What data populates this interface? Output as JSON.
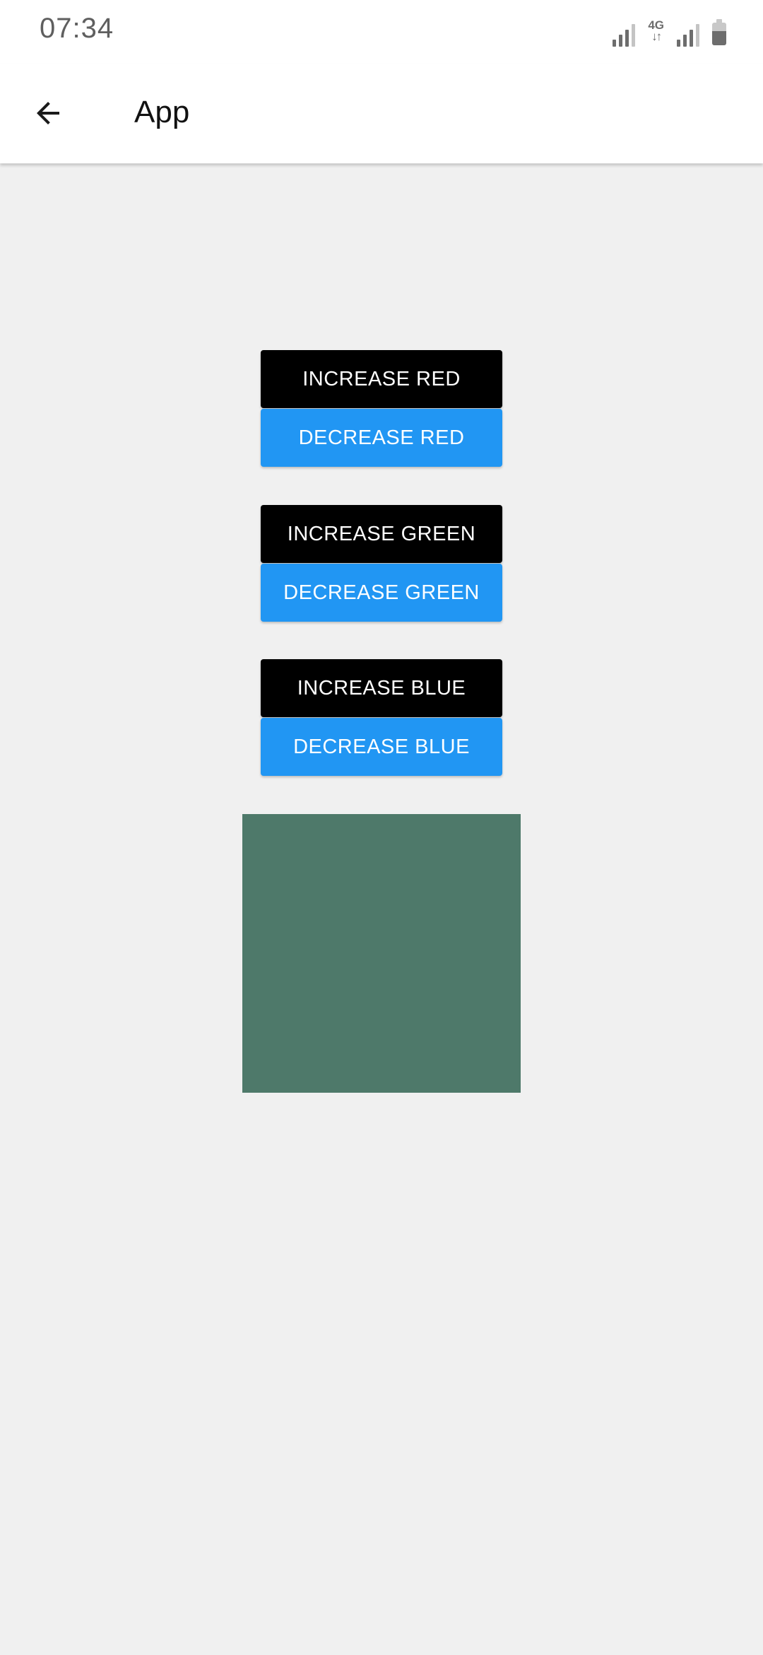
{
  "status_bar": {
    "time": "07:34",
    "network_type": "4G",
    "icons": [
      "signal-icon",
      "network-4g-icon",
      "signal-icon",
      "battery-icon"
    ]
  },
  "app_bar": {
    "title": "App",
    "back_icon": "arrow-left-icon"
  },
  "controls": {
    "increase_red": "INCREASE RED",
    "decrease_red": "DECREASE RED",
    "increase_green": "INCREASE GREEN",
    "decrease_green": "DECREASE GREEN",
    "increase_blue": "INCREASE BLUE",
    "decrease_blue": "DECREASE BLUE"
  },
  "colors": {
    "increase_button": "#000000",
    "decrease_button": "#2196f3",
    "preview_box": "#4e796a",
    "background": "#f0f0f0"
  }
}
